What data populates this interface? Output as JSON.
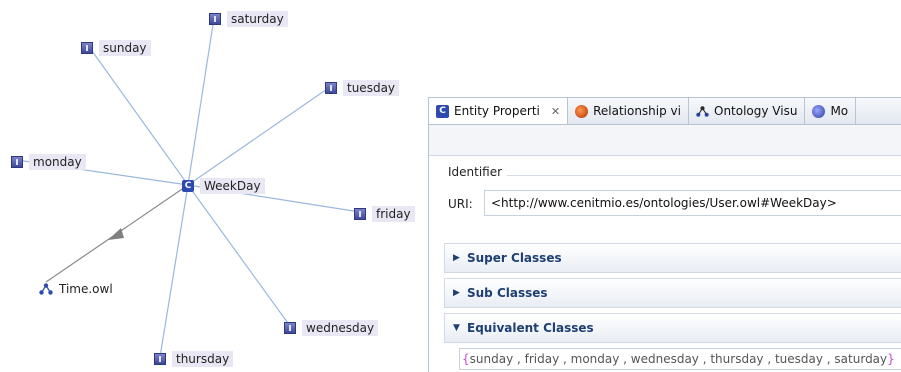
{
  "graph": {
    "center": "WeekDay",
    "individuals": {
      "saturday": "saturday",
      "sunday": "sunday",
      "tuesday": "tuesday",
      "monday": "monday",
      "friday": "friday",
      "wednesday": "wednesday",
      "thursday": "thursday"
    },
    "ontology": "Time.owl",
    "center_icon": "C"
  },
  "panel": {
    "tabs": [
      {
        "label": "Entity Properti",
        "icon": "class-icon"
      },
      {
        "label": "Relationship vi",
        "icon": "relationship-icon"
      },
      {
        "label": "Ontology Visu",
        "icon": "ontology-icon"
      },
      {
        "label": "Mo",
        "icon": "model-icon"
      }
    ],
    "identifier_title": "Identifier",
    "uri_label": "URI:",
    "uri_value": "<http://www.cenitmio.es/ontologies/User.owl#WeekDay>",
    "sections": {
      "super": "Super Classes",
      "sub": "Sub Classes",
      "equivalent": "Equivalent Classes"
    },
    "equivalent_value": "sunday , friday , monday , wednesday , thursday , tuesday , saturday",
    "equivalent_open": "{",
    "equivalent_close": "}"
  },
  "colors": {
    "edge": "#9bb8dd",
    "arrow": "#7f7f7f",
    "header_text": "#1f3f73"
  }
}
